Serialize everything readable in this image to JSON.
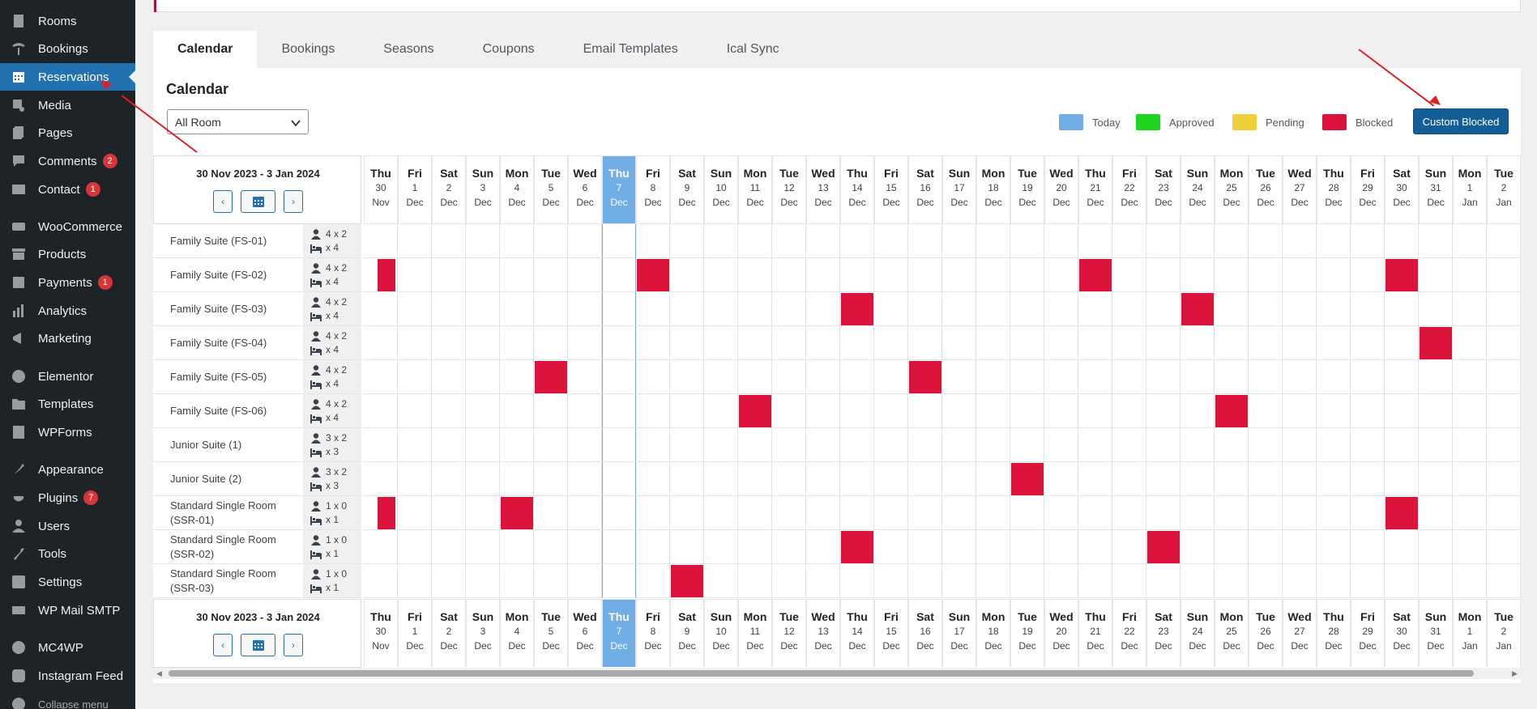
{
  "sidebar": {
    "items": [
      {
        "label": "Rooms",
        "icon": "building-icon",
        "badge": ""
      },
      {
        "label": "Bookings",
        "icon": "palm-icon",
        "badge": ""
      },
      {
        "label": "Reservations",
        "icon": "calendar-icon",
        "badge": "",
        "active": true
      },
      {
        "label": "Media",
        "icon": "media-icon",
        "badge": ""
      },
      {
        "label": "Pages",
        "icon": "pages-icon",
        "badge": ""
      },
      {
        "label": "Comments",
        "icon": "comment-icon",
        "badge": "2"
      },
      {
        "label": "Contact",
        "icon": "mail-icon",
        "badge": "1"
      },
      {
        "label": "WooCommerce",
        "icon": "woo-icon",
        "badge": ""
      },
      {
        "label": "Products",
        "icon": "archive-icon",
        "badge": ""
      },
      {
        "label": "Payments",
        "icon": "dollar-icon",
        "badge": "1"
      },
      {
        "label": "Analytics",
        "icon": "bar-chart-icon",
        "badge": ""
      },
      {
        "label": "Marketing",
        "icon": "megaphone-icon",
        "badge": ""
      },
      {
        "label": "Elementor",
        "icon": "elementor-icon",
        "badge": ""
      },
      {
        "label": "Templates",
        "icon": "folder-icon",
        "badge": ""
      },
      {
        "label": "WPForms",
        "icon": "form-icon",
        "badge": ""
      },
      {
        "label": "Appearance",
        "icon": "brush-icon",
        "badge": ""
      },
      {
        "label": "Plugins",
        "icon": "plugin-icon",
        "badge": "7"
      },
      {
        "label": "Users",
        "icon": "user-icon",
        "badge": ""
      },
      {
        "label": "Tools",
        "icon": "wrench-icon",
        "badge": ""
      },
      {
        "label": "Settings",
        "icon": "settings-icon",
        "badge": ""
      },
      {
        "label": "WP Mail SMTP",
        "icon": "smtp-icon",
        "badge": ""
      },
      {
        "label": "MC4WP",
        "icon": "mc4wp-icon",
        "badge": ""
      },
      {
        "label": "Instagram Feed",
        "icon": "instagram-icon",
        "badge": ""
      },
      {
        "label": "Collapse menu",
        "icon": "collapse-icon",
        "badge": ""
      }
    ]
  },
  "tabs": [
    "Calendar",
    "Bookings",
    "Seasons",
    "Coupons",
    "Email Templates",
    "Ical Sync"
  ],
  "active_tab": "Calendar",
  "panel": {
    "title": "Calendar",
    "room_filter": "All Room",
    "legend": [
      {
        "label": "Today",
        "color": "#72aee6"
      },
      {
        "label": "Approved",
        "color": "#1ed41e"
      },
      {
        "label": "Pending",
        "color": "#f0cf3a"
      },
      {
        "label": "Blocked",
        "color": "#dc143c"
      }
    ],
    "custom_blocked_label": "Custom Blocked",
    "date_range": "30 Nov 2023 - 3 Jan 2024",
    "prev_label": "‹",
    "next_label": "›"
  },
  "days": [
    {
      "d": "Thu",
      "n": "30",
      "m": "Nov"
    },
    {
      "d": "Fri",
      "n": "1",
      "m": "Dec"
    },
    {
      "d": "Sat",
      "n": "2",
      "m": "Dec"
    },
    {
      "d": "Sun",
      "n": "3",
      "m": "Dec"
    },
    {
      "d": "Mon",
      "n": "4",
      "m": "Dec"
    },
    {
      "d": "Tue",
      "n": "5",
      "m": "Dec"
    },
    {
      "d": "Wed",
      "n": "6",
      "m": "Dec"
    },
    {
      "d": "Thu",
      "n": "7",
      "m": "Dec",
      "today": true
    },
    {
      "d": "Fri",
      "n": "8",
      "m": "Dec"
    },
    {
      "d": "Sat",
      "n": "9",
      "m": "Dec"
    },
    {
      "d": "Sun",
      "n": "10",
      "m": "Dec"
    },
    {
      "d": "Mon",
      "n": "11",
      "m": "Dec"
    },
    {
      "d": "Tue",
      "n": "12",
      "m": "Dec"
    },
    {
      "d": "Wed",
      "n": "13",
      "m": "Dec"
    },
    {
      "d": "Thu",
      "n": "14",
      "m": "Dec"
    },
    {
      "d": "Fri",
      "n": "15",
      "m": "Dec"
    },
    {
      "d": "Sat",
      "n": "16",
      "m": "Dec"
    },
    {
      "d": "Sun",
      "n": "17",
      "m": "Dec"
    },
    {
      "d": "Mon",
      "n": "18",
      "m": "Dec"
    },
    {
      "d": "Tue",
      "n": "19",
      "m": "Dec"
    },
    {
      "d": "Wed",
      "n": "20",
      "m": "Dec"
    },
    {
      "d": "Thu",
      "n": "21",
      "m": "Dec"
    },
    {
      "d": "Fri",
      "n": "22",
      "m": "Dec"
    },
    {
      "d": "Sat",
      "n": "23",
      "m": "Dec"
    },
    {
      "d": "Sun",
      "n": "24",
      "m": "Dec"
    },
    {
      "d": "Mon",
      "n": "25",
      "m": "Dec"
    },
    {
      "d": "Tue",
      "n": "26",
      "m": "Dec"
    },
    {
      "d": "Wed",
      "n": "27",
      "m": "Dec"
    },
    {
      "d": "Thu",
      "n": "28",
      "m": "Dec"
    },
    {
      "d": "Fri",
      "n": "29",
      "m": "Dec"
    },
    {
      "d": "Sat",
      "n": "30",
      "m": "Dec"
    },
    {
      "d": "Sun",
      "n": "31",
      "m": "Dec"
    },
    {
      "d": "Mon",
      "n": "1",
      "m": "Jan"
    },
    {
      "d": "Tue",
      "n": "2",
      "m": "Jan"
    }
  ],
  "rooms": [
    {
      "name": "Family Suite (FS-01)",
      "guests": "4 x 2",
      "beds": "x 4",
      "blocked": []
    },
    {
      "name": "Family Suite (FS-02)",
      "guests": "4 x 2",
      "beds": "x 4",
      "blocked": [
        0,
        8,
        21,
        30
      ]
    },
    {
      "name": "Family Suite (FS-03)",
      "guests": "4 x 2",
      "beds": "x 4",
      "blocked": [
        14,
        24
      ]
    },
    {
      "name": "Family Suite (FS-04)",
      "guests": "4 x 2",
      "beds": "x 4",
      "blocked": [
        31
      ]
    },
    {
      "name": "Family Suite (FS-05)",
      "guests": "4 x 2",
      "beds": "x 4",
      "blocked": [
        5,
        16
      ]
    },
    {
      "name": "Family Suite (FS-06)",
      "guests": "4 x 2",
      "beds": "x 4",
      "blocked": [
        11,
        25
      ]
    },
    {
      "name": "Junior Suite (1)",
      "guests": "3 x 2",
      "beds": "x 3",
      "blocked": []
    },
    {
      "name": "Junior Suite (2)",
      "guests": "3 x 2",
      "beds": "x 3",
      "blocked": [
        19
      ]
    },
    {
      "name": "Standard Single Room (SSR-01)",
      "guests": "1 x 0",
      "beds": "x 1",
      "blocked": [
        0,
        4,
        30
      ]
    },
    {
      "name": "Standard Single Room (SSR-02)",
      "guests": "1 x 0",
      "beds": "x 1",
      "blocked": [
        14,
        23
      ]
    },
    {
      "name": "Standard Single Room (SSR-03)",
      "guests": "1 x 0",
      "beds": "x 1",
      "blocked": [
        9
      ]
    }
  ]
}
